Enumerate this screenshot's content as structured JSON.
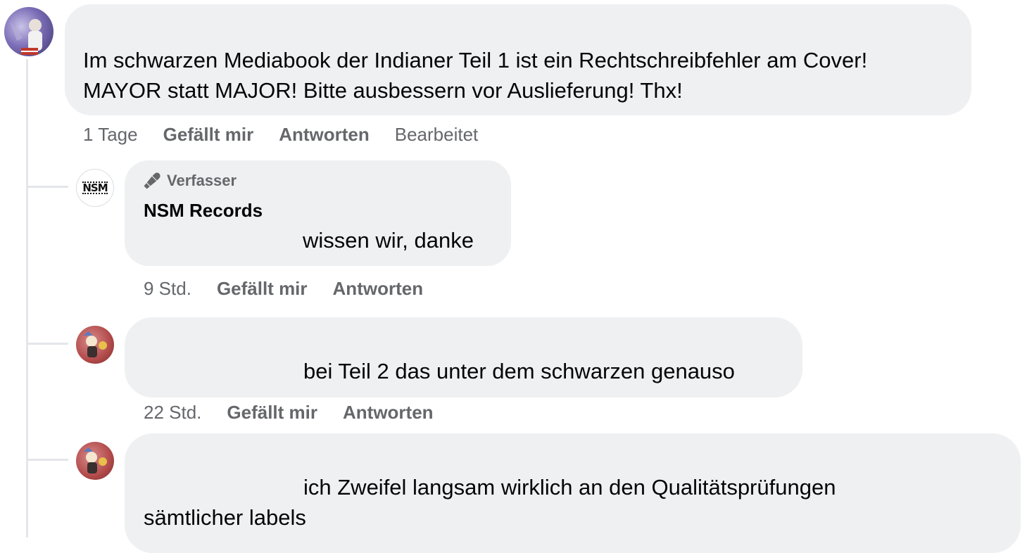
{
  "comment_main": {
    "text_line1": "Im schwarzen Mediabook der Indianer Teil 1 ist ein Rechtschreibfehler am Cover!",
    "text_line2": "MAYOR statt MAJOR! Bitte ausbessern vor Auslieferung! Thx!",
    "time": "1 Tage",
    "like_label": "Gefällt mir",
    "reply_label": "Antworten",
    "edited_label": "Bearbeitet"
  },
  "reply_1": {
    "badge": "Verfasser",
    "author": "NSM Records",
    "avatar_label": "NSM",
    "text": "wissen wir, danke",
    "time": "9 Std.",
    "like_label": "Gefällt mir",
    "reply_label": "Antworten"
  },
  "reply_2": {
    "text": "bei Teil 2 das unter dem schwarzen genauso",
    "time": "22 Std.",
    "like_label": "Gefällt mir",
    "reply_label": "Antworten"
  },
  "reply_3": {
    "text_line1": "ich Zweifel langsam wirklich an den Qualitätsprüfungen",
    "text_line2": "sämtlicher labels"
  },
  "colors": {
    "bubble": "#eff0f2",
    "meta_text": "#65676b",
    "thread_line": "#e4e6eb"
  }
}
